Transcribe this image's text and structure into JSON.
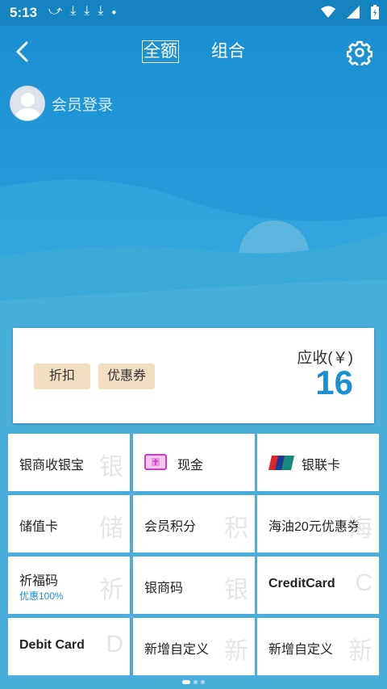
{
  "status_bar": {
    "time": "5:13",
    "notification_icons": [
      "missed-call-icon",
      "download-icon",
      "download-icon",
      "download-icon",
      "dot-icon"
    ],
    "right_icons": [
      "wifi-icon",
      "signal-icon",
      "battery-icon"
    ]
  },
  "header": {
    "tabs": [
      {
        "label": "全额",
        "active": true
      },
      {
        "label": "组合",
        "active": false
      }
    ],
    "member_label": "会员登录",
    "colors": {
      "primary": "#1b8fd1",
      "light": "#4aaedb"
    }
  },
  "payment": {
    "discount_label": "折扣",
    "coupon_label": "优惠券",
    "receivable_label": "应收(￥)",
    "amount": "16"
  },
  "methods": [
    {
      "label": "银商收银宝",
      "watermark": "银"
    },
    {
      "label": "现金",
      "icon": "cash-icon"
    },
    {
      "label": "银联卡",
      "icon": "unionpay-icon"
    },
    {
      "label": "储值卡",
      "watermark": "储"
    },
    {
      "label": "会员积分",
      "watermark": "积"
    },
    {
      "label": "海油20元优惠券",
      "watermark": "海"
    },
    {
      "label": "祈福码",
      "sub": "优惠100%",
      "watermark": "祈"
    },
    {
      "label": "银商码",
      "watermark": "银"
    },
    {
      "label": "CreditCard",
      "watermark": "C"
    },
    {
      "label": "Debit Card",
      "watermark": "D"
    },
    {
      "label": "新增自定义",
      "watermark": "新"
    },
    {
      "label": "新增自定义",
      "watermark": "新"
    }
  ],
  "pager": {
    "pages": 3,
    "current": 0
  }
}
